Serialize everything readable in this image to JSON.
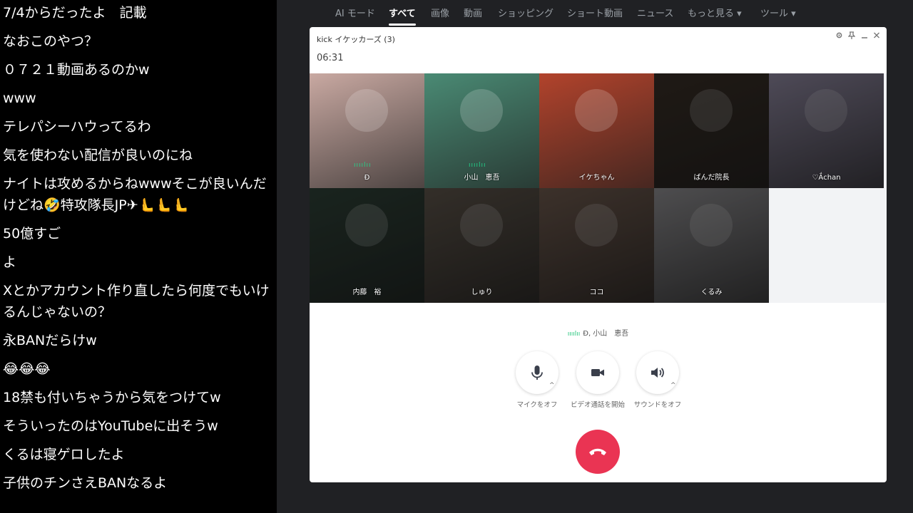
{
  "chat": {
    "messages": [
      "7/4からだったよ　記載",
      "なおこのやつ？",
      "０７２１動画あるのかw",
      "www",
      "テレパシーハウってるわ",
      "気を使わない配信が良いのにね",
      "ナイトは攻めるからねwwwそこが良いんだけどね🤣特攻隊長JP✈🫷🫷🫷",
      "50億すご",
      "よ",
      "Xとかアカウント作り直したら何度でもいけるんじゃないの？",
      "永BANだらけw",
      "😂😂😂",
      "18禁も付いちゃうから気をつけてw",
      "そういったのはYouTubeに出そうw",
      "くるは寝ゲロしたよ",
      "子供のチンさえBANなるよ"
    ]
  },
  "search_nav": {
    "items": [
      "AI モード",
      "すべて",
      "画像",
      "動画",
      "ショッピング",
      "ショート動画",
      "ニュース",
      "もっと見る",
      "ツール"
    ],
    "active": "すべて"
  },
  "call": {
    "group_title": "kick イケッカーズ (3)",
    "elapsed": "06:31",
    "window_controls": [
      "settings-icon",
      "pin-icon",
      "minimize-icon",
      "close-icon"
    ],
    "participants": [
      {
        "name": "Đ",
        "speaking": true,
        "dim": false,
        "color": "#c9a9a2"
      },
      {
        "name": "小山　恵吾",
        "speaking": true,
        "dim": false,
        "color": "#4a8a74"
      },
      {
        "name": "イケちゃん",
        "speaking": false,
        "dim": false,
        "color": "#b2432c"
      },
      {
        "name": "ばんだ院長",
        "speaking": false,
        "dim": true,
        "color": "#3a3028"
      },
      {
        "name": "♡Ắchan",
        "speaking": false,
        "dim": true,
        "color": "#8f88a0"
      },
      {
        "name": "内藤　裕",
        "speaking": false,
        "dim": true,
        "color": "#2f4238"
      },
      {
        "name": "しゅり",
        "speaking": false,
        "dim": true,
        "color": "#5e554b"
      },
      {
        "name": "ココ",
        "speaking": false,
        "dim": true,
        "color": "#6e5a4e"
      },
      {
        "name": "くるみ",
        "speaking": false,
        "dim": true,
        "color": "#8e8d90"
      }
    ],
    "speaking_now": "Đ, 小山　恵吾",
    "controls": {
      "mic_label": "マイクをオフ",
      "video_label": "ビデオ通話を開始",
      "sound_label": "サウンドをオフ"
    },
    "end_call_icon": "hang-up-icon"
  }
}
